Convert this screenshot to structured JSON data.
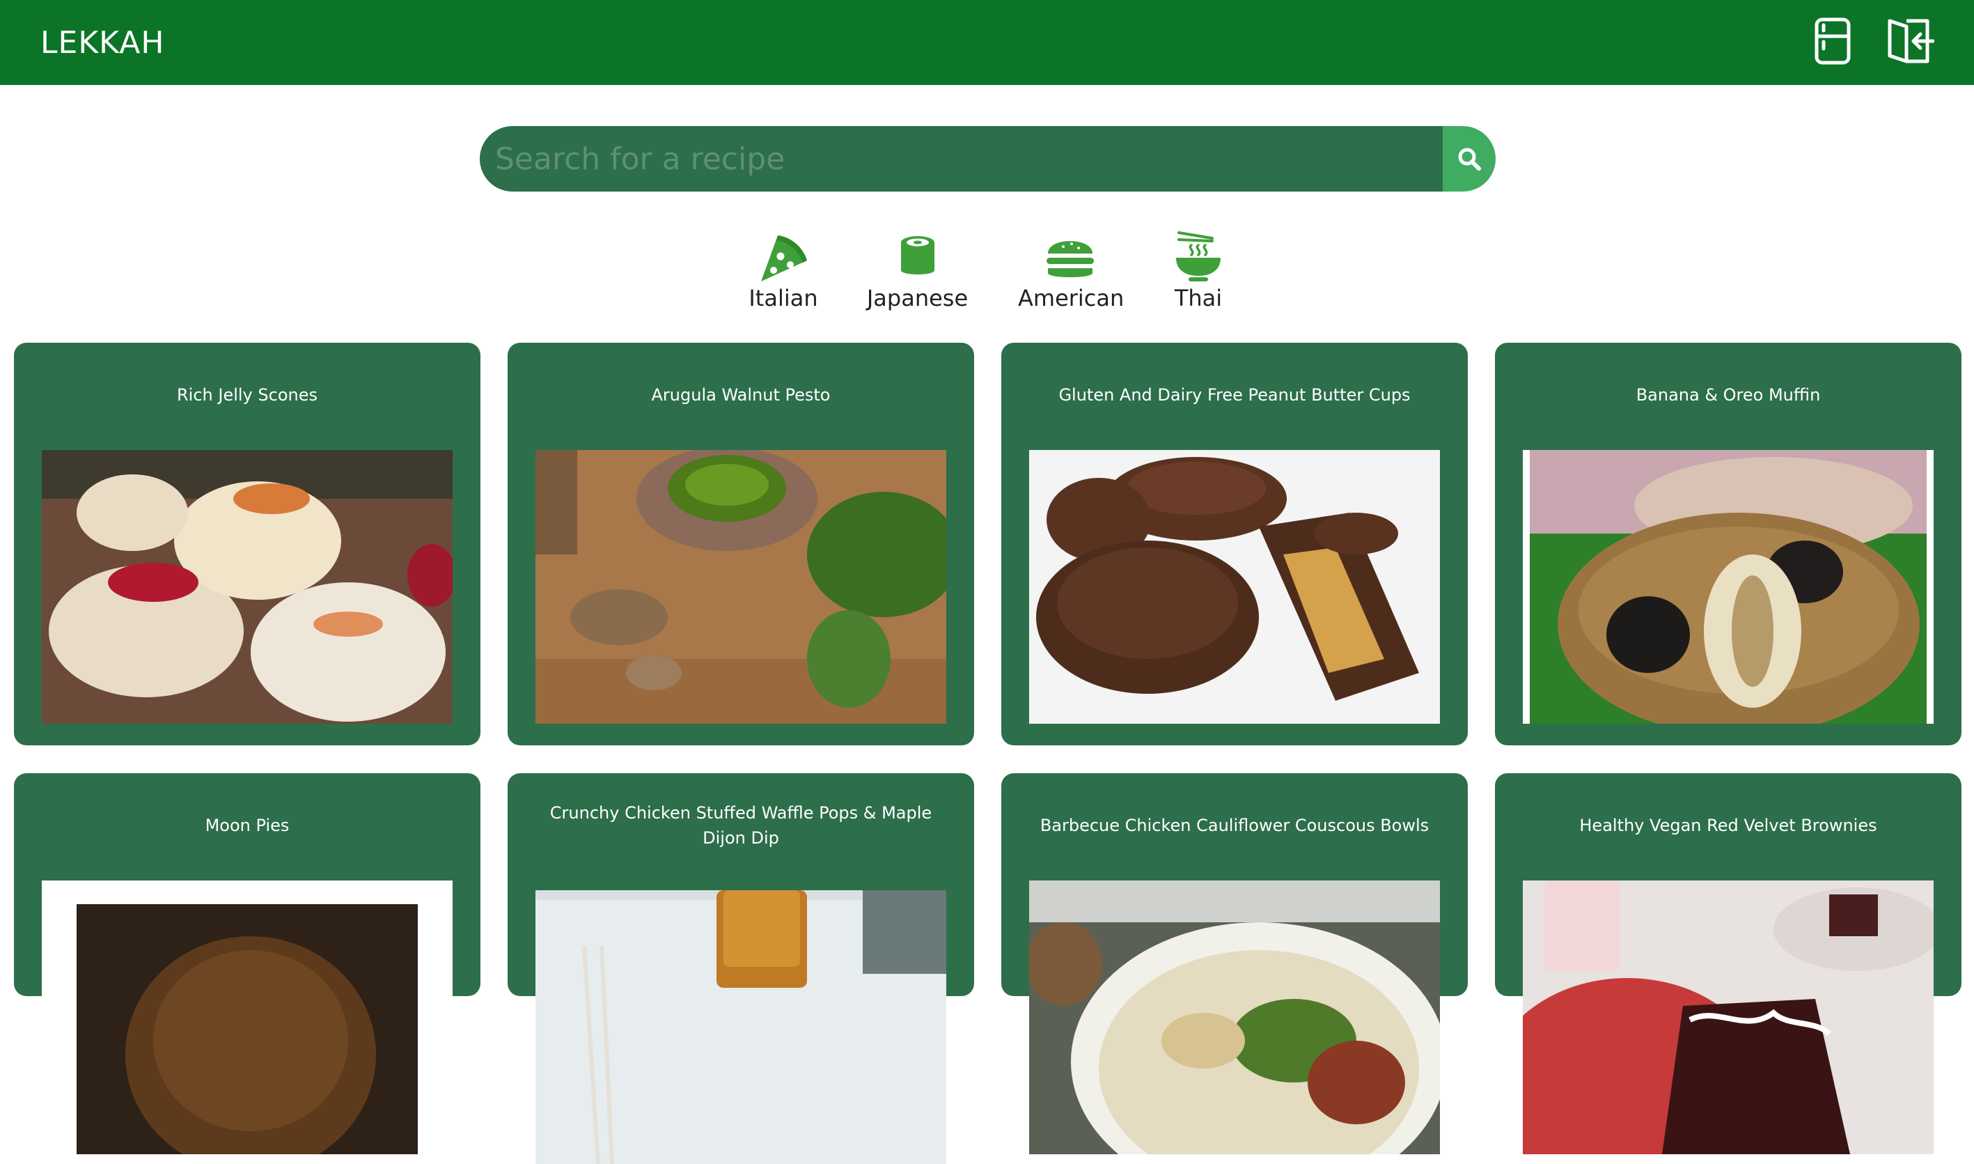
{
  "app": {
    "brand": "LEKKAH",
    "nav_icons": [
      "fridge-icon",
      "logout-icon"
    ]
  },
  "search": {
    "placeholder": "Search for a recipe",
    "button_icon": "search-icon"
  },
  "cuisines": [
    {
      "label": "Italian",
      "icon": "pizza-icon"
    },
    {
      "label": "Japanese",
      "icon": "sushi-icon"
    },
    {
      "label": "American",
      "icon": "burger-icon"
    },
    {
      "label": "Thai",
      "icon": "noodle-bowl-icon"
    }
  ],
  "recipes": [
    {
      "title": "Rich Jelly Scones"
    },
    {
      "title": "Arugula Walnut Pesto"
    },
    {
      "title": "Gluten And Dairy Free Peanut Butter Cups"
    },
    {
      "title": "Banana & Oreo Muffin"
    },
    {
      "title": "Moon Pies"
    },
    {
      "title": "Crunchy Chicken Stuffed Waffle Pops & Maple Dijon Dip"
    },
    {
      "title": "Barbecue Chicken Cauliflower Couscous Bowls"
    },
    {
      "title": "Healthy Vegan Red Velvet Brownies"
    }
  ],
  "colors": {
    "nav": "#0b7427",
    "card": "#2d6e4b",
    "search_button": "#3fac62",
    "icon_green": "#3fa03a"
  }
}
